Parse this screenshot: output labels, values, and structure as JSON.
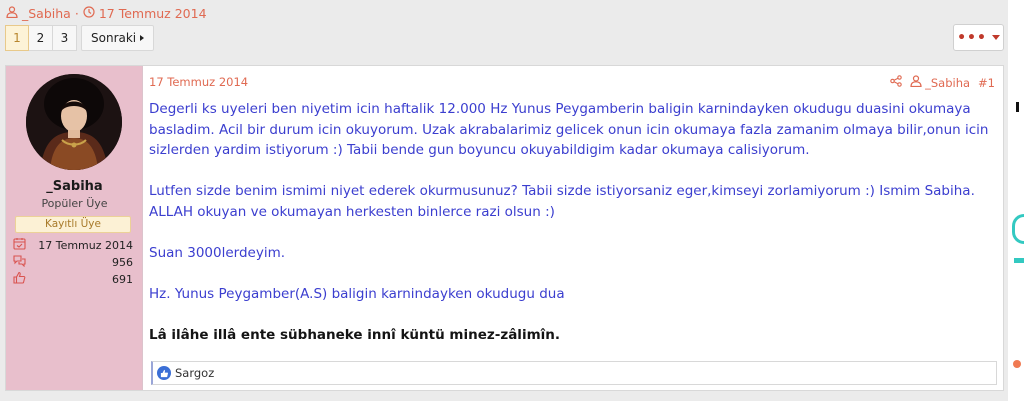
{
  "thread": {
    "author": "_Sabiha",
    "separator": "·",
    "date": "17 Temmuz 2014"
  },
  "pagination": {
    "pages": [
      "1",
      "2",
      "3"
    ],
    "current": "1",
    "next_label": "Sonraki"
  },
  "more_menu": {
    "label": "•••"
  },
  "post": {
    "date": "17 Temmuz 2014",
    "author": "_Sabiha",
    "number": "#1",
    "paragraphs": [
      "Degerli ks uyeleri ben niyetim icin haftalik 12.000 Hz Yunus Peygamberin baligin karnindayken okudugu duasini okumaya basladim. Acil bir durum icin okuyorum. Uzak akrabalarimiz gelicek onun icin okumaya fazla zamanim olmaya bilir,onun icin sizlerden yardim istiyorum :) Tabii bende gun boyuncu okuyabildigim kadar okumaya calisiyorum.",
      "Lutfen sizde benim ismimi niyet ederek okurmusunuz? Tabii sizde istiyorsaniz eger,kimseyi zorlamiyorum :) Ismim Sabiha. ALLAH okuyan ve okumayan herkesten binlerce razi olsun :)",
      "Suan 3000lerdeyim.",
      "Hz. Yunus Peygamber(A.S) baligin karnindayken okudugu dua"
    ],
    "prayer": "Lâ ilâhe illâ ente sübhaneke innî küntü minez-zâlimîn.",
    "reaction_user": "Sargoz"
  },
  "user": {
    "name": "_Sabiha",
    "title": "Popüler Üye",
    "banner": "Kayıtlı Üye",
    "joined": "17 Temmuz 2014",
    "messages": "956",
    "reactions": "691"
  },
  "colors": {
    "accent": "#e06a52",
    "post_text": "#3b3ecf",
    "user_cell_bg": "#e8bfcc",
    "banner_bg": "#fcf1d5"
  }
}
